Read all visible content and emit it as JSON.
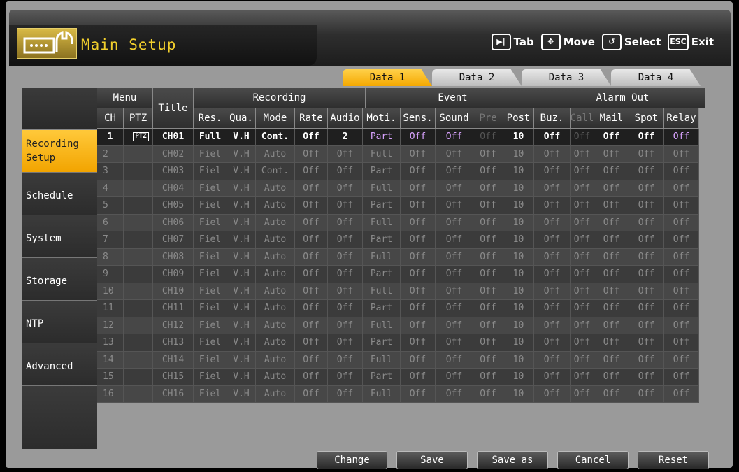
{
  "header": {
    "title": "Main Setup",
    "hints": [
      {
        "key": "▶|",
        "label": "Tab",
        "icon": "tab-icon"
      },
      {
        "key": "✥",
        "label": "Move",
        "icon": "move-icon"
      },
      {
        "key": "↺",
        "label": "Select",
        "icon": "select-icon"
      },
      {
        "key": "ESC",
        "label": "Exit",
        "icon": "esc-icon"
      }
    ]
  },
  "tabs": [
    "Data 1",
    "Data 2",
    "Data 3",
    "Data 4"
  ],
  "active_tab": "Data 1",
  "sidebar": {
    "items": [
      {
        "line1": "Recording",
        "line2": "Setup"
      },
      {
        "line1": "Schedule",
        "line2": ""
      },
      {
        "line1": "System",
        "line2": ""
      },
      {
        "line1": "Storage",
        "line2": ""
      },
      {
        "line1": "NTP",
        "line2": ""
      },
      {
        "line1": "Advanced",
        "line2": ""
      }
    ]
  },
  "table": {
    "groups": {
      "menu": "Menu",
      "title": "Title",
      "recording": "Recording",
      "event": "Event",
      "alarm_out": "Alarm Out"
    },
    "columns": [
      "CH",
      "PTZ",
      "Title",
      "Res.",
      "Qua.",
      "Mode",
      "Rate",
      "Audio",
      "Moti.",
      "Sens.",
      "Sound",
      "Pre",
      "Post",
      "Buz.",
      "Call",
      "Mail",
      "Spot",
      "Relay"
    ],
    "first_row": {
      "ch": "1",
      "ptz": "PTZ",
      "title": "CH01",
      "res": "Full",
      "qua": "V.H",
      "mode": "Cont.",
      "rate": "Off",
      "audio": "2",
      "moti": "Part",
      "sens": "Off",
      "sound": "Off",
      "pre": "Off",
      "post": "10",
      "buz": "Off",
      "call": "Off",
      "mail": "Off",
      "spot": "Off",
      "relay": "Off"
    },
    "rows": [
      [
        "2",
        "CH02",
        "Fiel",
        "V.H",
        "Auto",
        "Off",
        "Off",
        "Full",
        "Off",
        "Off",
        "Off",
        "10",
        "Off",
        "Off",
        "Off",
        "Off",
        "Off"
      ],
      [
        "3",
        "CH03",
        "Fiel",
        "V.H",
        "Cont.",
        "Off",
        "Off",
        "Part",
        "Off",
        "Off",
        "Off",
        "10",
        "Off",
        "Off",
        "Off",
        "Off",
        "Off"
      ],
      [
        "4",
        "CH04",
        "Fiel",
        "V.H",
        "Auto",
        "Off",
        "Off",
        "Full",
        "Off",
        "Off",
        "Off",
        "10",
        "Off",
        "Off",
        "Off",
        "Off",
        "Off"
      ],
      [
        "5",
        "CH05",
        "Fiel",
        "V.H",
        "Auto",
        "Off",
        "Off",
        "Part",
        "Off",
        "Off",
        "Off",
        "10",
        "Off",
        "Off",
        "Off",
        "Off",
        "Off"
      ],
      [
        "6",
        "CH06",
        "Fiel",
        "V.H",
        "Auto",
        "Off",
        "Off",
        "Full",
        "Off",
        "Off",
        "Off",
        "10",
        "Off",
        "Off",
        "Off",
        "Off",
        "Off"
      ],
      [
        "7",
        "CH07",
        "Fiel",
        "V.H",
        "Auto",
        "Off",
        "Off",
        "Part",
        "Off",
        "Off",
        "Off",
        "10",
        "Off",
        "Off",
        "Off",
        "Off",
        "Off"
      ],
      [
        "8",
        "CH08",
        "Fiel",
        "V.H",
        "Auto",
        "Off",
        "Off",
        "Full",
        "Off",
        "Off",
        "Off",
        "10",
        "Off",
        "Off",
        "Off",
        "Off",
        "Off"
      ],
      [
        "9",
        "CH09",
        "Fiel",
        "V.H",
        "Auto",
        "Off",
        "Off",
        "Part",
        "Off",
        "Off",
        "Off",
        "10",
        "Off",
        "Off",
        "Off",
        "Off",
        "Off"
      ],
      [
        "10",
        "CH10",
        "Fiel",
        "V.H",
        "Auto",
        "Off",
        "Off",
        "Full",
        "Off",
        "Off",
        "Off",
        "10",
        "Off",
        "Off",
        "Off",
        "Off",
        "Off"
      ],
      [
        "11",
        "CH11",
        "Fiel",
        "V.H",
        "Auto",
        "Off",
        "Off",
        "Part",
        "Off",
        "Off",
        "Off",
        "10",
        "Off",
        "Off",
        "Off",
        "Off",
        "Off"
      ],
      [
        "12",
        "CH12",
        "Fiel",
        "V.H",
        "Auto",
        "Off",
        "Off",
        "Full",
        "Off",
        "Off",
        "Off",
        "10",
        "Off",
        "Off",
        "Off",
        "Off",
        "Off"
      ],
      [
        "13",
        "CH13",
        "Fiel",
        "V.H",
        "Auto",
        "Off",
        "Off",
        "Part",
        "Off",
        "Off",
        "Off",
        "10",
        "Off",
        "Off",
        "Off",
        "Off",
        "Off"
      ],
      [
        "14",
        "CH14",
        "Fiel",
        "V.H",
        "Auto",
        "Off",
        "Off",
        "Full",
        "Off",
        "Off",
        "Off",
        "10",
        "Off",
        "Off",
        "Off",
        "Off",
        "Off"
      ],
      [
        "15",
        "CH15",
        "Fiel",
        "V.H",
        "Auto",
        "Off",
        "Off",
        "Part",
        "Off",
        "Off",
        "Off",
        "10",
        "Off",
        "Off",
        "Off",
        "Off",
        "Off"
      ],
      [
        "16",
        "CH16",
        "Fiel",
        "V.H",
        "Auto",
        "Off",
        "Off",
        "Full",
        "Off",
        "Off",
        "Off",
        "10",
        "Off",
        "Off",
        "Off",
        "Off",
        "Off"
      ]
    ]
  },
  "buttons": [
    "Change",
    "Save",
    "Save as",
    "Cancel",
    "Reset"
  ],
  "colors": {
    "accent": "#f5a800",
    "title": "#f2cf2c",
    "highlight_value": "#d9a3ff"
  }
}
